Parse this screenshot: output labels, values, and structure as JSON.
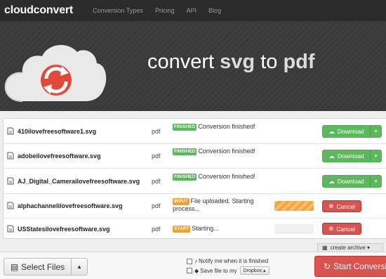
{
  "nav": {
    "brand": "cloudconvert",
    "links": [
      "Conversion Types",
      "Pricing",
      "API",
      "Blog"
    ]
  },
  "hero": {
    "title_prefix": "convert ",
    "from_format": "svg",
    "title_mid": " to ",
    "to_format": "pdf"
  },
  "files": [
    {
      "name": "410ilovefreesoftware1.svg",
      "format": "pdf",
      "badge": "FINISHED",
      "status": "Conversion finished!",
      "action": "Download"
    },
    {
      "name": "adobeilovefreesoftware.svg",
      "format": "pdf",
      "badge": "FINISHED",
      "status": "Conversion finished!",
      "action": "Download"
    },
    {
      "name": "AJ_Digital_Camerailovefreesoftware.svg",
      "format": "pdf",
      "badge": "FINISHED",
      "status": "Conversion finished!",
      "action": "Download"
    },
    {
      "name": "alphachannelilovefreesoftware.svg",
      "format": "pdf",
      "badge": "INPUT",
      "status": "File uploaded. Starting process...",
      "action": "Cancel",
      "progress": 1.0
    },
    {
      "name": "USStatesilovefreesoftware.svg",
      "format": "pdf",
      "badge": "START",
      "status": "Starting...",
      "action": "Cancel",
      "progress": 0.0
    }
  ],
  "archive_label": "create archive",
  "bottom": {
    "select_files": "Select Files",
    "notify_label": "Notify me when it is finished",
    "save_label": "Save file to my",
    "dropbox_label": "Dropbox",
    "start_label": "Start Conversion"
  },
  "colors": {
    "success": "#5cb85c",
    "danger": "#d9534f",
    "warning": "#f0a030",
    "nav_bg": "#2b2b2b"
  }
}
